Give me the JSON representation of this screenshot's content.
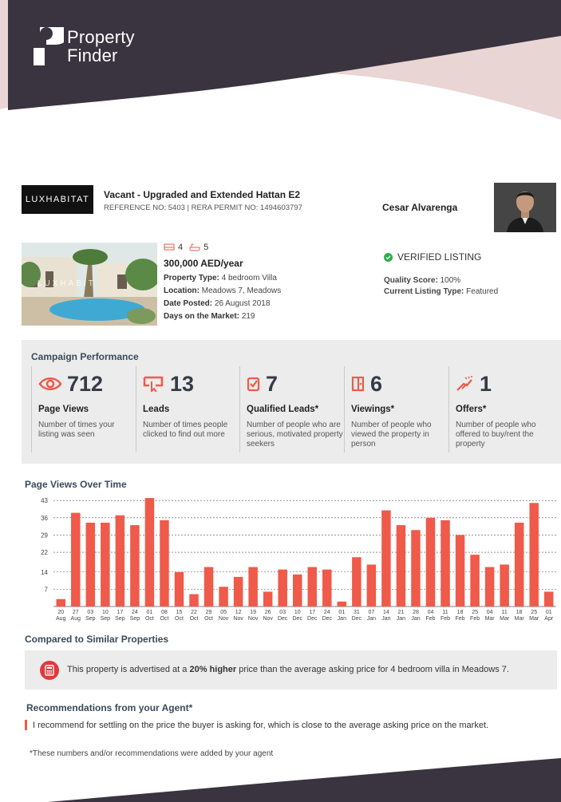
{
  "brand": {
    "line1": "Property",
    "line2": "Finder"
  },
  "listing": {
    "agency": "LUXHABITAT",
    "title": "Vacant - Upgraded and Extended Hattan E2",
    "reference": "REFERENCE NO: 5403 | RERA PERMIT NO: 1494603797",
    "agent_name": "Cesar Alvarenga",
    "photo_watermark": "LUXHABIT",
    "beds": "4",
    "baths": "5",
    "price": "300,000 AED/year",
    "details": [
      {
        "label": "Property Type:",
        "value": "4 bedroom Villa"
      },
      {
        "label": "Location:",
        "value": "Meadows 7, Meadows"
      },
      {
        "label": "Date Posted:",
        "value": "26 August 2018"
      },
      {
        "label": "Days on the Market:",
        "value": "219"
      }
    ],
    "verified": "VERIFIED LISTING",
    "quality_label": "Quality Score:",
    "quality_value": "100%",
    "type_label": "Current Listing Type:",
    "type_value": "Featured"
  },
  "campaign": {
    "title": "Campaign Performance",
    "metrics": [
      {
        "icon": "eye-icon",
        "value": "712",
        "label": "Page Views",
        "desc": "Number of times your listing was seen"
      },
      {
        "icon": "lead-click-icon",
        "value": "13",
        "label": "Leads",
        "desc": "Number of times people clicked to find out more"
      },
      {
        "icon": "checkbox-icon",
        "value": "7",
        "label": "Qualified Leads*",
        "desc": "Number of people who are serious, motivated property seekers"
      },
      {
        "icon": "door-icon",
        "value": "6",
        "label": "Viewings*",
        "desc": "Number of people who viewed the property in person"
      },
      {
        "icon": "handshake-icon",
        "value": "1",
        "label": "Offers*",
        "desc": "Number of people who offered to buy/rent the property"
      }
    ]
  },
  "chart_data": {
    "type": "bar",
    "title": "Page Views Over Time",
    "categories": [
      "20 Aug",
      "27 Aug",
      "03 Sep",
      "10 Sep",
      "17 Sep",
      "24 Sep",
      "01 Oct",
      "08 Oct",
      "15 Oct",
      "22 Oct",
      "29 Oct",
      "05 Nov",
      "12 Nov",
      "19 Nov",
      "26 Nov",
      "03 Dec",
      "10 Dec",
      "17 Dec",
      "24 Dec",
      "01 Jan",
      "31 Dec",
      "07 Jan",
      "14 Jan",
      "21 Jan",
      "28 Jan",
      "04 Feb",
      "11 Feb",
      "18 Feb",
      "25 Feb",
      "04 Mar",
      "11 Mar",
      "18 Mar",
      "25 Mar",
      "01 Apr"
    ],
    "tick_day": [
      "20",
      "27",
      "03",
      "10",
      "17",
      "24",
      "01",
      "08",
      "15",
      "22",
      "29",
      "05",
      "12",
      "19",
      "26",
      "03",
      "10",
      "17",
      "24",
      "01",
      "31",
      "07",
      "14",
      "21",
      "28",
      "04",
      "11",
      "18",
      "25",
      "04",
      "11",
      "18",
      "25",
      "01"
    ],
    "tick_month": [
      "Aug",
      "Aug",
      "Sep",
      "Sep",
      "Sep",
      "Sep",
      "Oct",
      "Oct",
      "Oct",
      "Oct",
      "Oct",
      "Nov",
      "Nov",
      "Nov",
      "Nov",
      "Dec",
      "Dec",
      "Dec",
      "Dec",
      "Jan",
      "Dec",
      "Jan",
      "Jan",
      "Jan",
      "Jan",
      "Feb",
      "Feb",
      "Feb",
      "Feb",
      "Mar",
      "Mar",
      "Mar",
      "Mar",
      "Apr"
    ],
    "values": [
      3,
      38,
      34,
      34,
      37,
      33,
      44,
      35,
      14,
      5,
      16,
      8,
      12,
      16,
      6,
      15,
      13,
      16,
      15,
      2,
      20,
      17,
      39,
      33,
      31,
      36,
      35,
      29,
      21,
      16,
      17,
      34,
      42,
      6
    ],
    "yticks": [
      7,
      14,
      22,
      29,
      36,
      43
    ],
    "ylim": [
      0,
      45
    ],
    "color": "#ef5a4a",
    "grid": true
  },
  "compare": {
    "title": "Compared to Similar Properties",
    "text_before": "This property is advertised at a ",
    "text_bold": "20% higher",
    "text_after": " price than the average asking price for 4 bedroom villa in Meadows 7."
  },
  "recommendation": {
    "title": "Recommendations from your Agent*",
    "text": "I recommend for settling on the price the buyer is asking for, which is close to the average asking price on the market."
  },
  "note": "*These numbers and/or recommendations were added by your agent",
  "colors": {
    "accent": "#ef5a4a",
    "dark": "#3a3340",
    "pink": "#e9d5d4",
    "panel": "#ececec"
  }
}
